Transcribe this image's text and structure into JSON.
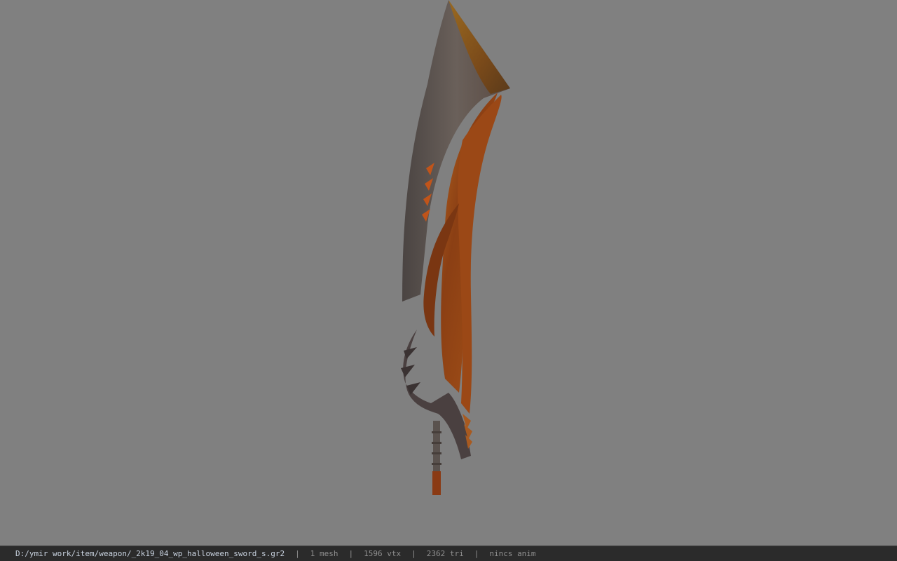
{
  "viewport": {
    "background_color": "#808080",
    "model_name": "sword-3d-model"
  },
  "statusbar": {
    "file_path": "D:/ymir work/item/weapon/_2k19_04_wp_halloween_sword_s.gr2",
    "separator": "|",
    "mesh_count": "1 mesh",
    "vertex_count": "1596 vtx",
    "triangle_count": "2362 tri",
    "anim_status": "nincs anim"
  },
  "colors": {
    "status_bg": "#2b2b2b",
    "path_text": "#c9d3e0",
    "info_text": "#8f8f8f",
    "blade_rust": "#8a4a1c",
    "blade_steel": "#5a5250"
  }
}
